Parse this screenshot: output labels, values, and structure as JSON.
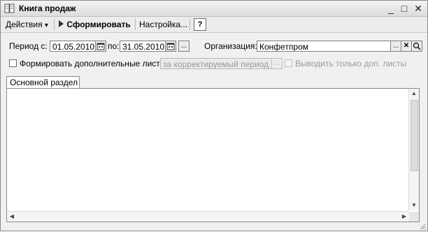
{
  "window": {
    "title": "Книга продаж",
    "controls": [
      "_",
      "□",
      "✕"
    ]
  },
  "toolbar": {
    "actions_label": "Действия",
    "actions_arrow": "▾",
    "generate_label": "Сформировать",
    "settings_label": "Настройка...",
    "help_label": "?"
  },
  "period": {
    "from_label": "Период с:",
    "from_value": "01.05.2010",
    "to_label": "по:",
    "to_value": "31.05.2010",
    "select_label": "..."
  },
  "organization": {
    "label": "Организация:",
    "value": "Конфетпром",
    "select_label": "...",
    "clear_label": "✕",
    "open_label": "Q"
  },
  "options": {
    "additional_sheets_label": "Формировать дополнительные листы",
    "period_placeholder": "за корректируемый период",
    "select_label": "...",
    "only_additional_label": "Выводить только доп. листы"
  },
  "tabs": [
    {
      "label": "Основной раздел"
    }
  ],
  "icons": {
    "title": "book-icon",
    "generate": "play-arrow-icon",
    "calendar": "calendar-icon"
  }
}
